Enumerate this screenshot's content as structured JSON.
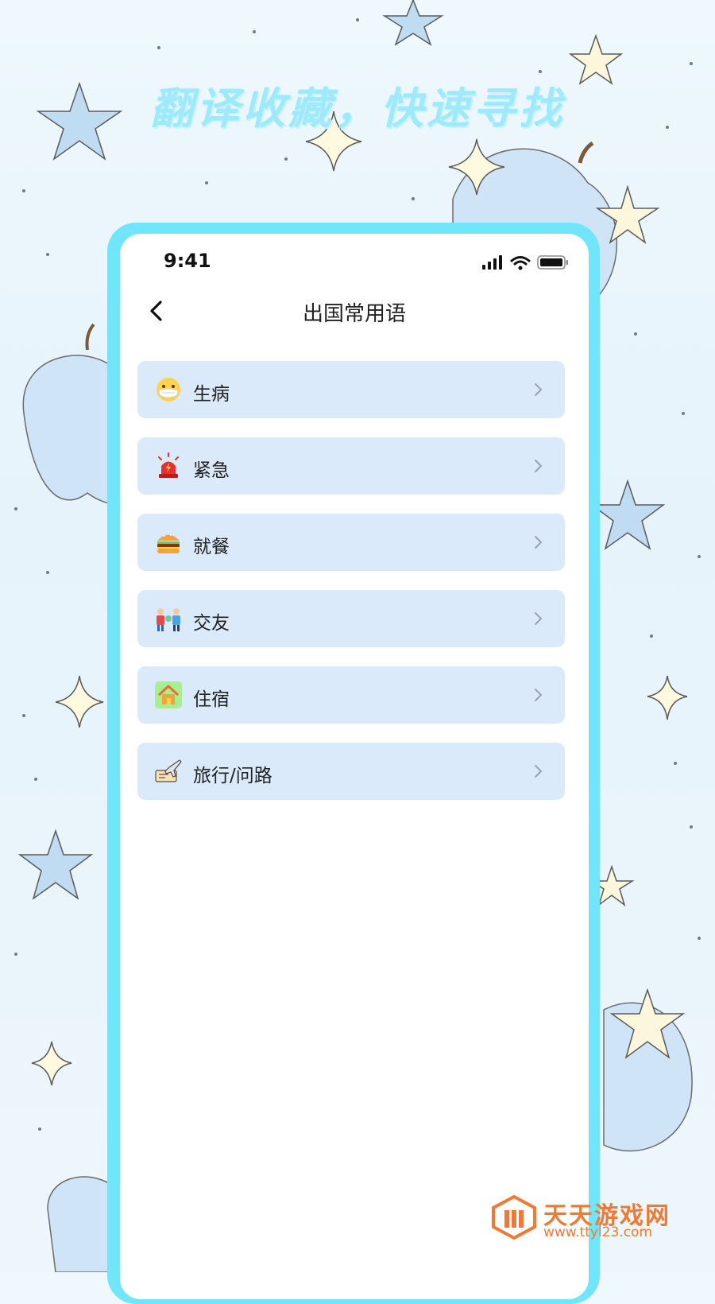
{
  "banner": {
    "headline": "翻译收藏，快速寻找"
  },
  "status_bar": {
    "time": "9:41"
  },
  "nav": {
    "title": "出国常用语"
  },
  "categories": [
    {
      "label": "生病",
      "icon": "mask-face-icon"
    },
    {
      "label": "紧急",
      "icon": "alarm-siren-icon"
    },
    {
      "label": "就餐",
      "icon": "burger-icon"
    },
    {
      "label": "交友",
      "icon": "people-handshake-icon"
    },
    {
      "label": "住宿",
      "icon": "house-icon"
    },
    {
      "label": "旅行/问路",
      "icon": "plane-ticket-icon"
    }
  ],
  "watermark": {
    "name": "天天游戏网",
    "url": "www.ttyl23.com"
  },
  "colors": {
    "phone_frame": "#71e6fb",
    "item_bg": "#dbeafb",
    "headline": "#9ee9fb",
    "watermark": "#f07a35"
  }
}
